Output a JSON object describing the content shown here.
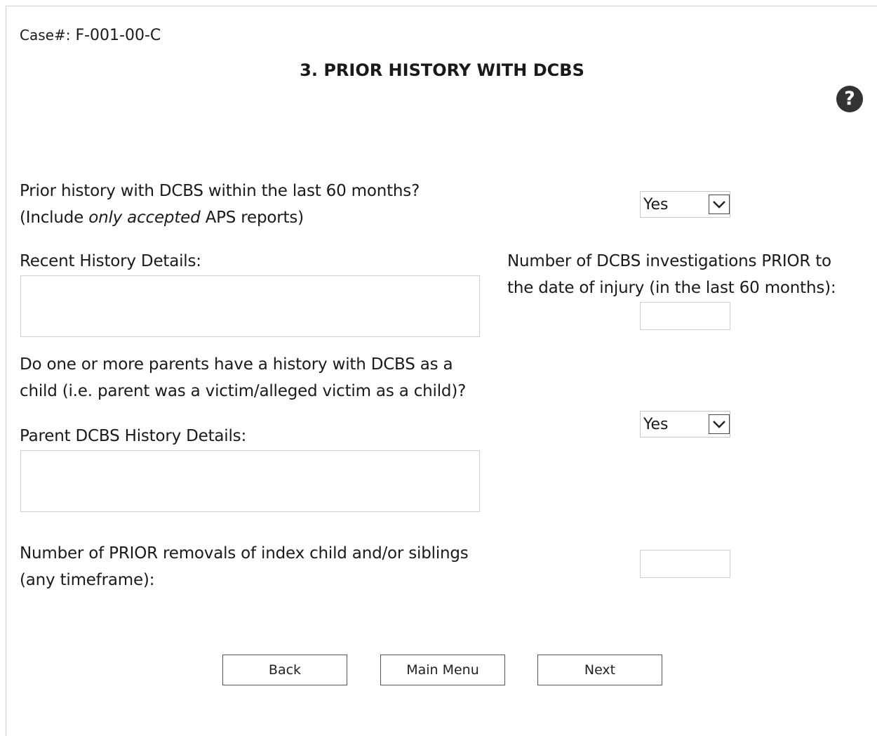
{
  "header": {
    "case_label": "Case#:",
    "case_number": "F-001-00-C",
    "title": "3. PRIOR HISTORY WITH DCBS",
    "help_icon_glyph": "?"
  },
  "form": {
    "prior_history": {
      "line1": "Prior history with DCBS within the last 60 months?",
      "line2_pre": "(Include ",
      "line2_em": "only accepted",
      "line2_post": " APS reports)",
      "selected": "Yes"
    },
    "recent_history": {
      "label": "Recent History Details:",
      "value": ""
    },
    "investigations": {
      "line1": "Number of DCBS investigations PRIOR to",
      "line2": "the date of injury (in the last 60 months):",
      "value": ""
    },
    "parent_history": {
      "line1": "Do one or more parents have a history with DCBS as a",
      "line2": "child (i.e. parent was a victim/alleged victim as a child)?",
      "selected": "Yes"
    },
    "parent_details": {
      "label": "Parent DCBS History Details:",
      "value": ""
    },
    "removals": {
      "line1": "Number of PRIOR removals of index child and/or siblings",
      "line2": "(any timeframe):",
      "value": ""
    }
  },
  "buttons": {
    "back": "Back",
    "main_menu": "Main Menu",
    "next": "Next"
  },
  "colors": {
    "border": "#cfcfcf",
    "help_icon_bg": "#333333"
  }
}
